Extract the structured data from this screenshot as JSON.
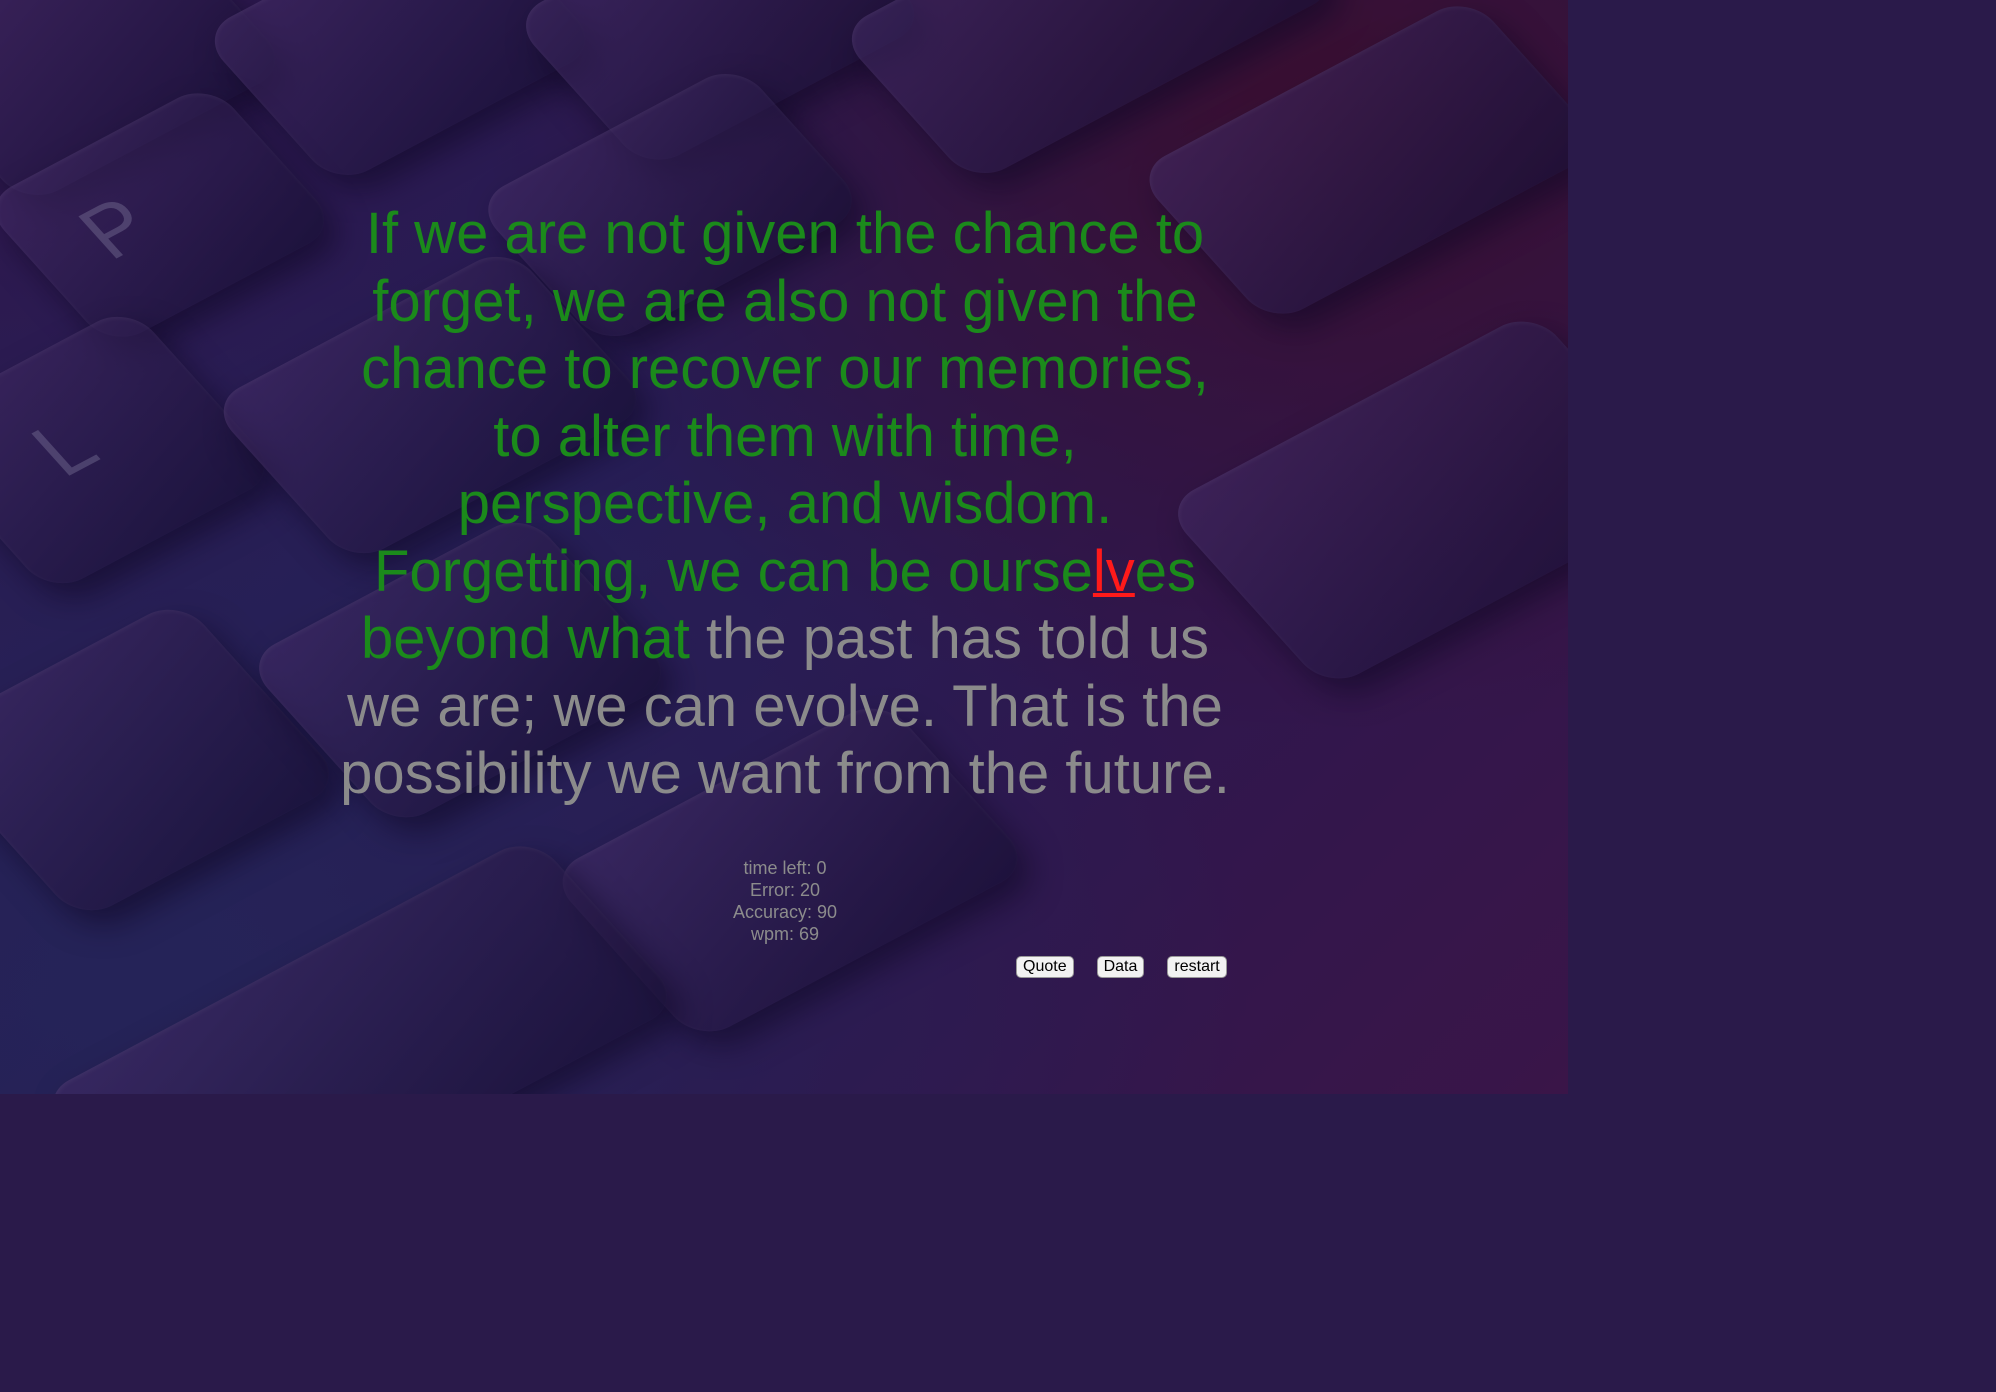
{
  "quote": {
    "typed_before_error": "If we are not given the chance to forget, we are also not given the chance to recover our memories, to alter them with time, perspective, and wisdom. Forgetting, we can be ourse",
    "error_chars": "lv",
    "typed_after_error": "es beyond what",
    "remaining": " the past has told us we are; we can evolve. That is the possibility we want from the future."
  },
  "stats": {
    "time_left": "time left: 0",
    "error": "Error: 20",
    "accuracy": "Accuracy: 90",
    "wpm": "wpm: 69"
  },
  "buttons": {
    "quote_label": "Quote",
    "data_label": "Data",
    "restart_label": "restart"
  },
  "colors": {
    "typed": "#1b8a1b",
    "error": "#ff1a1a",
    "remaining": "#8b8b8b"
  }
}
